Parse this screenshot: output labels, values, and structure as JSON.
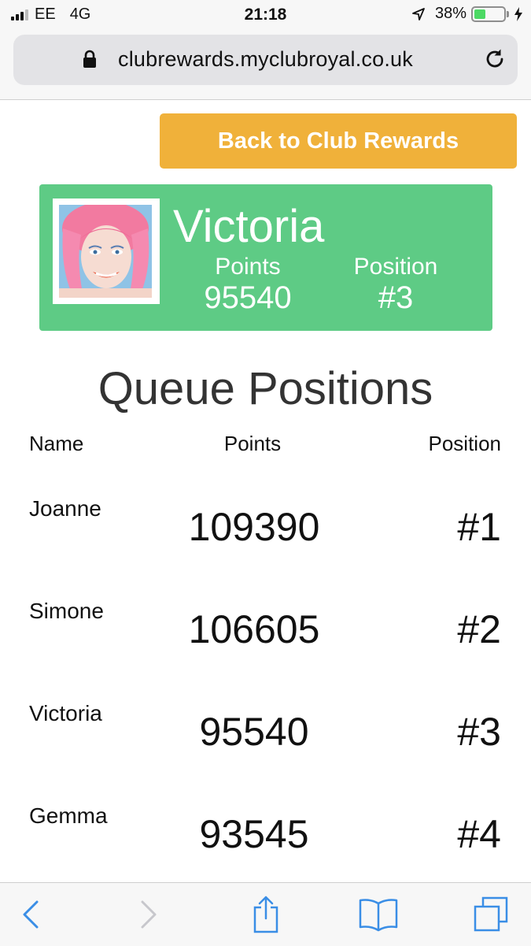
{
  "status_bar": {
    "carrier": "EE",
    "network": "4G",
    "time": "21:18",
    "battery_percent": "38%",
    "battery_level": 0.38
  },
  "browser": {
    "url": "clubrewards.myclubroyal.co.uk"
  },
  "back_button": {
    "label": "Back to Club Rewards"
  },
  "profile": {
    "name": "Victoria",
    "points_label": "Points",
    "points": "95540",
    "position_label": "Position",
    "position": "#3"
  },
  "queue": {
    "title": "Queue Positions",
    "headers": {
      "name": "Name",
      "points": "Points",
      "position": "Position"
    },
    "rows": [
      {
        "name": "Joanne",
        "points": "109390",
        "position": "#1"
      },
      {
        "name": "Simone",
        "points": "106605",
        "position": "#2"
      },
      {
        "name": "Victoria",
        "points": "95540",
        "position": "#3"
      },
      {
        "name": "Gemma",
        "points": "93545",
        "position": "#4"
      }
    ]
  },
  "colors": {
    "accent_orange": "#f0b13a",
    "card_green": "#5ecb85",
    "ios_blue": "#3a8ee6"
  },
  "toolbar": {
    "icons": [
      "back-icon",
      "forward-icon",
      "share-icon",
      "bookmarks-icon",
      "tabs-icon"
    ]
  }
}
